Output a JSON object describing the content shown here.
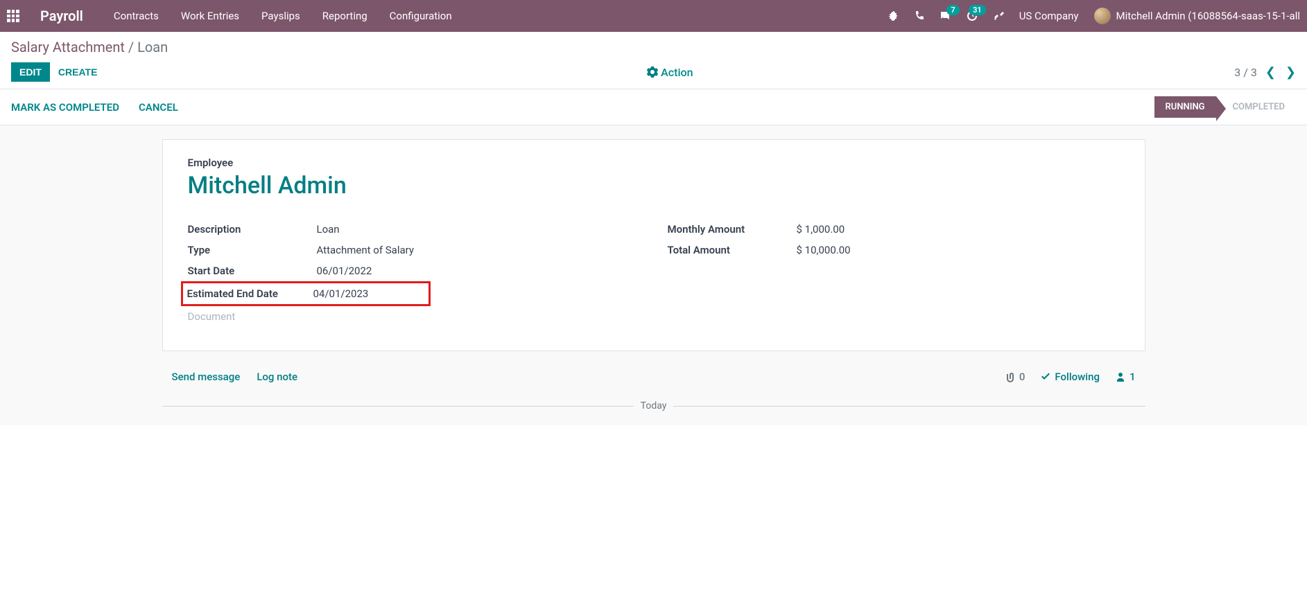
{
  "navbar": {
    "brand": "Payroll",
    "links": [
      "Contracts",
      "Work Entries",
      "Payslips",
      "Reporting",
      "Configuration"
    ],
    "messages_badge": "7",
    "activities_badge": "31",
    "company": "US Company",
    "user": "Mitchell Admin (16088564-saas-15-1-all"
  },
  "breadcrumb": {
    "parent": "Salary Attachment",
    "current": "Loan"
  },
  "buttons": {
    "edit": "EDIT",
    "create": "CREATE",
    "action": "Action",
    "mark_completed": "MARK AS COMPLETED",
    "cancel": "CANCEL"
  },
  "pager": {
    "text": "3 / 3"
  },
  "status": {
    "running": "RUNNING",
    "completed": "COMPLETED"
  },
  "form": {
    "employee_label": "Employee",
    "employee_name": "Mitchell Admin",
    "left": [
      {
        "label": "Description",
        "value": "Loan"
      },
      {
        "label": "Type",
        "value": "Attachment of Salary"
      },
      {
        "label": "Start Date",
        "value": "06/01/2022"
      },
      {
        "label": "Estimated End Date",
        "value": "04/01/2023"
      }
    ],
    "document": "Document",
    "right": [
      {
        "label": "Monthly Amount",
        "value": "$ 1,000.00"
      },
      {
        "label": "Total Amount",
        "value": "$ 10,000.00"
      }
    ]
  },
  "chatter": {
    "send_message": "Send message",
    "log_note": "Log note",
    "attachments": "0",
    "following": "Following",
    "followers_count": "1",
    "today": "Today"
  }
}
